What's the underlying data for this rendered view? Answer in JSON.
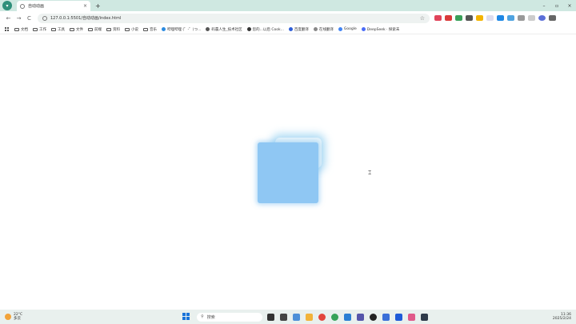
{
  "browser": {
    "tab": {
      "title": "自动动画",
      "close": "×"
    },
    "new_tab": "+",
    "window": {
      "minimize": "–",
      "restore": "▫",
      "close": "×"
    },
    "nav": {
      "back": "←",
      "forward": "→",
      "reload": "C"
    },
    "address": {
      "url": "127.0.0.1:5501/自动动画/index.html",
      "star": "☆"
    }
  },
  "bookmarks": [
    {
      "label": "文档",
      "kind": "folder"
    },
    {
      "label": "工作",
      "kind": "folder"
    },
    {
      "label": "工具",
      "kind": "folder"
    },
    {
      "label": "文件",
      "kind": "folder"
    },
    {
      "label": "前端",
      "kind": "folder"
    },
    {
      "label": "资料",
      "kind": "folder"
    },
    {
      "label": "小说",
      "kind": "folder"
    },
    {
      "label": "音乐",
      "kind": "folder"
    },
    {
      "label": "哔哩哔哩 (゜-゜)つ...",
      "kind": "site",
      "color": "#2b8be0"
    },
    {
      "label": "码農人生_技术社区",
      "kind": "site",
      "color": "#555555"
    },
    {
      "label": "您的...以后 Cook...",
      "kind": "site",
      "color": "#333333"
    },
    {
      "label": "百度翻译",
      "kind": "site",
      "color": "#2f5fd8"
    },
    {
      "label": "在线翻译",
      "kind": "site",
      "color": "#888888"
    },
    {
      "label": "Google",
      "kind": "site",
      "color": "#4285f4"
    },
    {
      "label": "DeepSeek · 探索未",
      "kind": "site",
      "color": "#4a6cf7"
    }
  ],
  "taskbar": {
    "weather": {
      "temp": "22°C",
      "desc": "多云"
    },
    "search_placeholder": "搜索",
    "clock": {
      "time": "11:36",
      "date": "2025/2/24"
    }
  }
}
